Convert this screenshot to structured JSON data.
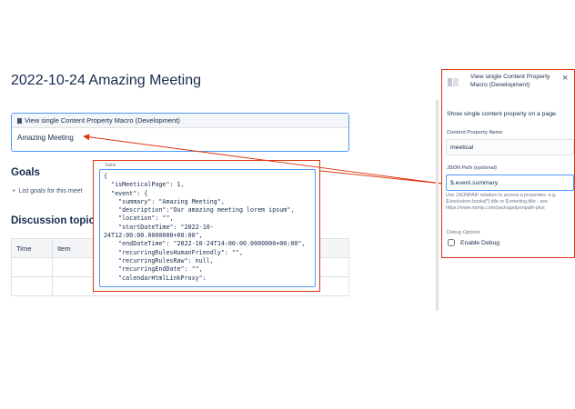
{
  "page": {
    "title": "2022-10-24 Amazing Meeting",
    "macro_header": "View single Content Property Macro (Development)",
    "macro_value": "Amazing Meeting",
    "goals_heading": "Goals",
    "goals_bullet": "List goals for this meet",
    "discussion_heading": "Discussion topics",
    "table_headers": [
      "Time",
      "Item"
    ]
  },
  "json_popup": {
    "label": "Value",
    "text": "{\n  \"isMeeticalPage\": 1,\n  \"event\": {\n    \"summary\": \"Amazing Meeting\",\n    \"description\":\"Our amazing meeting lorem ipsum\",\n    \"location\": \"\",\n    \"startDateTime\": \"2022-10-\n24T12:00:00.0000000+00:00\",\n    \"endDateTime\": \"2022-10-24T14:00:00.0000000+00:00\",\n    \"recurringRulesHumanFriendly\": \"\",\n    \"recurringRulesRaw\": null,\n    \"recurringEndDate\": \"\",\n    \"calendarHtmlLinkProxy\":"
  },
  "panel": {
    "title": "View single Content Property Macro (Development)",
    "close_icon": "×",
    "description": "Show single content property on a page.",
    "property_label": "Content Property Name",
    "property_value": "meetical",
    "json_path_label": "JSON Path (optional)",
    "json_path_value": "$.event.summary",
    "help_text": "Use JSONPAth notation to access a properties. e.g. $.bookstore.books[*].title or $.meeting.title - see https://www.npmjs.com/package/jsonpath-plus",
    "debug_label": "Debug Options",
    "debug_checkbox_label": "Enable Debug",
    "debug_checked": false
  },
  "colors": {
    "annotation_red": "#de350b",
    "focus_blue": "#4c9aff"
  }
}
